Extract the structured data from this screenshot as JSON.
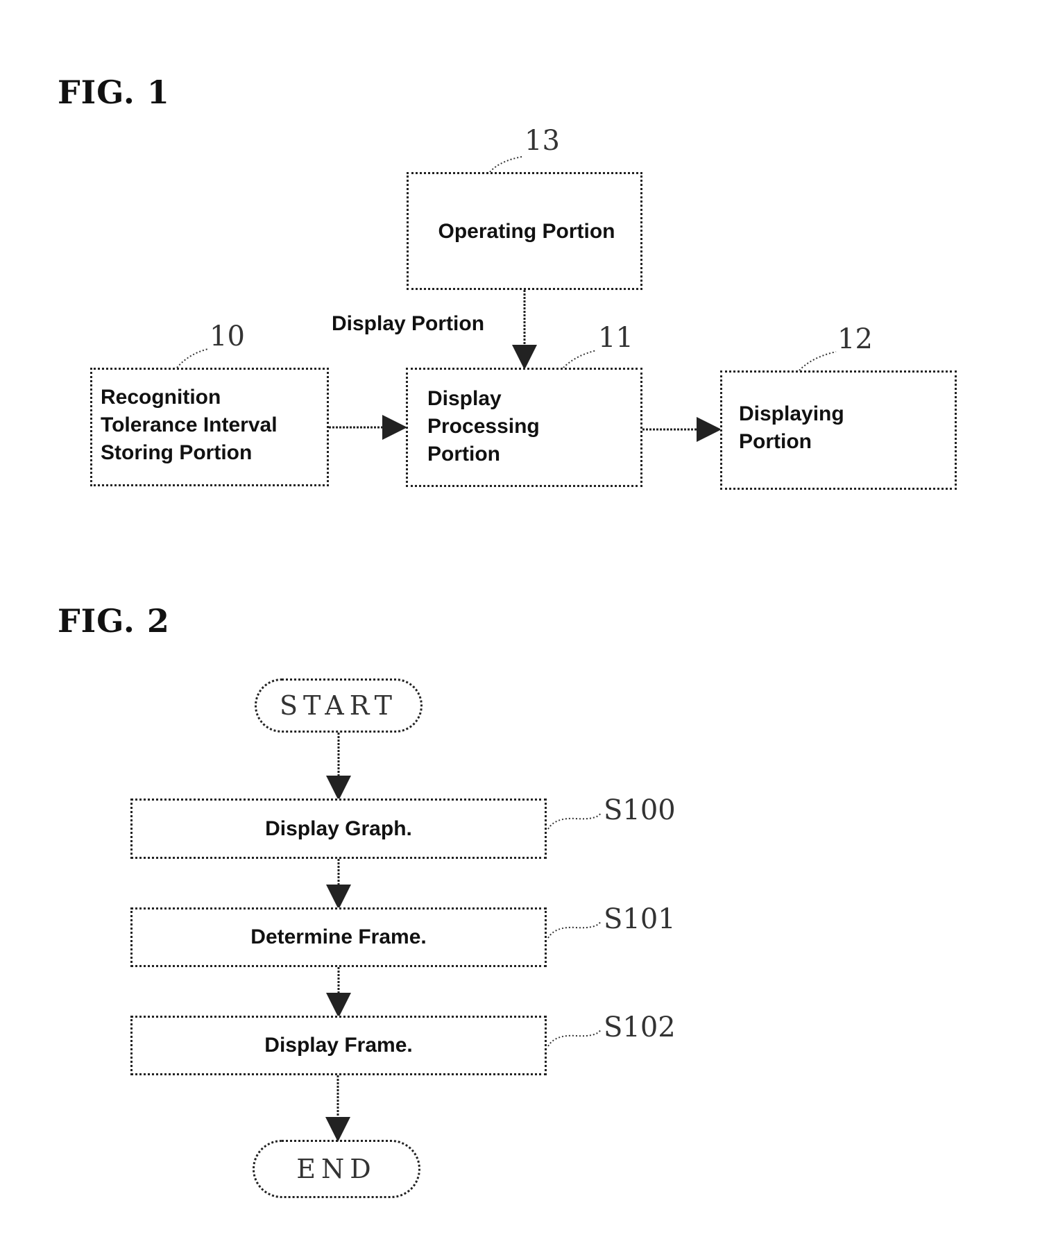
{
  "fig1": {
    "title": "FIG. 1",
    "blocks": [
      {
        "ref": "13",
        "lines": [
          "Operating Portion"
        ]
      },
      {
        "ref": "10",
        "lines": [
          "Recognition",
          "Tolerance Interval",
          "Storing Portion"
        ]
      },
      {
        "ref": "11",
        "lines": [
          "Display",
          "Processing",
          "Portion"
        ]
      },
      {
        "ref": "12",
        "lines": [
          "Displaying",
          "Portion"
        ]
      }
    ],
    "arrow_label": "Display Portion"
  },
  "fig2": {
    "title": "FIG. 2",
    "start": "START",
    "steps": [
      {
        "ref": "S100",
        "label": "Display Graph."
      },
      {
        "ref": "S101",
        "label": "Determine Frame."
      },
      {
        "ref": "S102",
        "label": "Display Frame."
      }
    ],
    "end": "END"
  }
}
